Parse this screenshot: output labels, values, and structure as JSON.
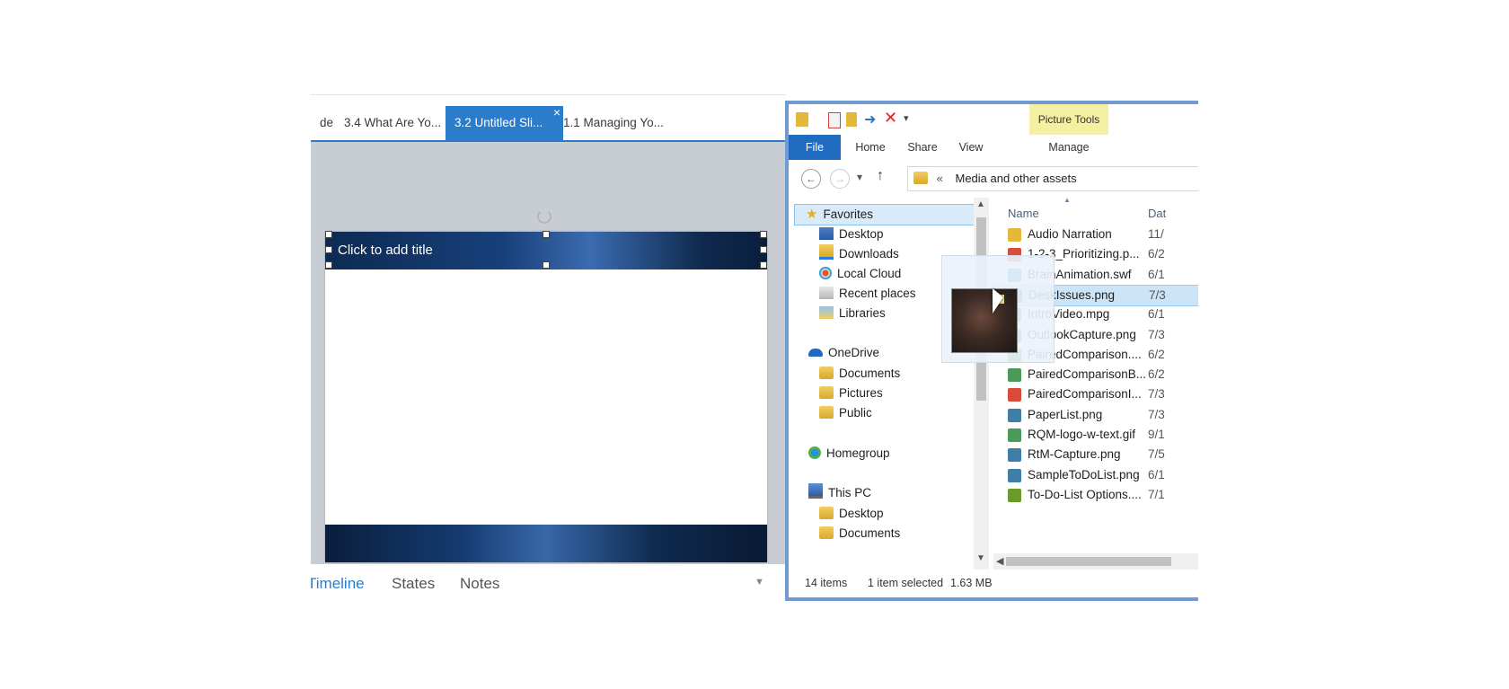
{
  "editor": {
    "tabs": [
      {
        "label": "de"
      },
      {
        "label": "3.4 What Are Yo..."
      },
      {
        "label": "3.2 Untitled Sli...",
        "active": true
      },
      {
        "label": "1.1 Managing Yo..."
      }
    ],
    "close_glyph": "×",
    "slide": {
      "title_placeholder": "Click to add title"
    },
    "bottom_tabs": [
      {
        "label": "Timeline",
        "selected": true
      },
      {
        "label": "States"
      },
      {
        "label": "Notes"
      }
    ],
    "bottom_arrow": "▼"
  },
  "explorer": {
    "qat_icons": [
      "folder-icon",
      "properties-icon",
      "new-folder-icon",
      "undo-icon",
      "delete-icon",
      "customize-icon"
    ],
    "picture_tools_label": "Picture Tools",
    "ribbon_tabs": [
      "File",
      "Home",
      "Share",
      "View",
      "Manage"
    ],
    "nav": {
      "back": "←",
      "forward": "→",
      "recent": "▾",
      "up": "↑"
    },
    "address": {
      "separator": "«",
      "path": "Media and other assets"
    },
    "nav_pane": {
      "favorites_label": "Favorites",
      "favorites": [
        "Desktop",
        "Downloads",
        "Local Cloud",
        "Recent places",
        "Libraries"
      ],
      "onedrive_label": "OneDrive",
      "onedrive": [
        "Documents",
        "Pictures",
        "Public"
      ],
      "homegroup_label": "Homegroup",
      "thispc_label": "This PC",
      "thispc": [
        "Desktop",
        "Documents"
      ]
    },
    "columns": {
      "name": "Name",
      "date": "Dat"
    },
    "files": [
      {
        "name": "Audio Narration",
        "date": "11/",
        "icon": "folder-icon",
        "color": "#e4b83a"
      },
      {
        "name": "1-2-3_Prioritizing.p...",
        "date": "6/2",
        "icon": "pdf-icon",
        "color": "#d84b3a"
      },
      {
        "name": "BrainAnimation.swf",
        "date": "6/1",
        "icon": "globe-icon",
        "color": "#3a8fd8"
      },
      {
        "name": "DeskIssues.png",
        "date": "7/3",
        "icon": "image-icon",
        "color": "#3f7ea8",
        "selected": true
      },
      {
        "name": "IntroVideo.mpg",
        "date": "6/1",
        "icon": "video-icon",
        "color": "#6d6d6d"
      },
      {
        "name": "OutlookCapture.png",
        "date": "7/3",
        "icon": "image-icon",
        "color": "#3f7ea8"
      },
      {
        "name": "PairedComparison....",
        "date": "6/2",
        "icon": "image-icon",
        "color": "#4a9a5a"
      },
      {
        "name": "PairedComparisonB...",
        "date": "6/2",
        "icon": "image-icon",
        "color": "#4a9a5a"
      },
      {
        "name": "PairedComparisonI...",
        "date": "7/3",
        "icon": "pdf-icon",
        "color": "#d84b3a"
      },
      {
        "name": "PaperList.png",
        "date": "7/3",
        "icon": "image-icon",
        "color": "#3f7ea8"
      },
      {
        "name": "RQM-logo-w-text.gif",
        "date": "9/1",
        "icon": "image-icon",
        "color": "#4a9a5a"
      },
      {
        "name": "RtM-Capture.png",
        "date": "7/5",
        "icon": "image-icon",
        "color": "#3f7ea8"
      },
      {
        "name": "SampleToDoList.png",
        "date": "6/1",
        "icon": "image-icon",
        "color": "#3f7ea8"
      },
      {
        "name": "To-Do-List Options....",
        "date": "7/1",
        "icon": "script-icon",
        "color": "#6a9a2a"
      }
    ],
    "status": {
      "items": "14 items",
      "selected": "1 item selected",
      "size": "1.63 MB"
    }
  }
}
